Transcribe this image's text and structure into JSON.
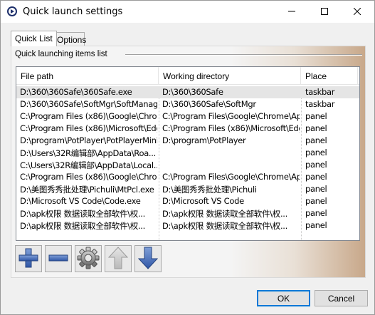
{
  "window": {
    "title": "Quick launch settings"
  },
  "tabs": [
    {
      "label": "Quick List"
    },
    {
      "label": "Options"
    }
  ],
  "panel": {
    "section_label": "Quick launching items list"
  },
  "list": {
    "columns": [
      "File path",
      "Working directory",
      "Place"
    ],
    "rows": [
      {
        "path": "D:\\360\\360Safe\\360Safe.exe",
        "dir": "D:\\360\\360Safe",
        "place": "taskbar",
        "selected": true
      },
      {
        "path": "D:\\360\\360Safe\\SoftMgr\\SoftManag...",
        "dir": "D:\\360\\360Safe\\SoftMgr",
        "place": "taskbar"
      },
      {
        "path": "C:\\Program Files (x86)\\Google\\Chrom...",
        "dir": "C:\\Program Files\\Google\\Chrome\\Ap...",
        "place": "panel"
      },
      {
        "path": "C:\\Program Files (x86)\\Microsoft\\Edge...",
        "dir": "C:\\Program Files (x86)\\Microsoft\\Edg...",
        "place": "panel"
      },
      {
        "path": "D:\\program\\PotPlayer\\PotPlayerMini6...",
        "dir": "D:\\program\\PotPlayer",
        "place": "panel"
      },
      {
        "path": "D:\\Users\\32R编辑部\\AppData\\Roa...",
        "dir": "",
        "place": "panel"
      },
      {
        "path": "C:\\Users\\32R编辑部\\AppData\\Local...",
        "dir": "",
        "place": "panel"
      },
      {
        "path": "C:\\Program Files (x86)\\Google\\Chrom...",
        "dir": "C:\\Program Files\\Google\\Chrome\\Ap...",
        "place": "panel"
      },
      {
        "path": "D:\\美图秀秀批处理\\Pichuli\\MtPcl.exe",
        "dir": "D:\\美图秀秀批处理\\Pichuli",
        "place": "panel"
      },
      {
        "path": "D:\\Microsoft VS Code\\Code.exe",
        "dir": "D:\\Microsoft VS Code",
        "place": "panel"
      },
      {
        "path": "D:\\apk权限 数据读取全部软件\\权...",
        "dir": "D:\\apk权限 数据读取全部软件\\权...",
        "place": "panel"
      },
      {
        "path": "D:\\apk权限 数据读取全部软件\\权...",
        "dir": "D:\\apk权限 数据读取全部软件\\权...",
        "place": "panel"
      }
    ]
  },
  "toolbar": {
    "buttons": [
      {
        "icon": "plus-icon"
      },
      {
        "icon": "minus-icon"
      },
      {
        "icon": "gear-icon"
      },
      {
        "icon": "arrow-up-icon",
        "disabled": true
      },
      {
        "icon": "arrow-down-icon"
      }
    ]
  },
  "buttons": {
    "ok": "OK",
    "cancel": "Cancel"
  },
  "colors": {
    "icon_blue": "#3d68b5",
    "icon_gray": "#777777",
    "accent": "#0078d7"
  }
}
